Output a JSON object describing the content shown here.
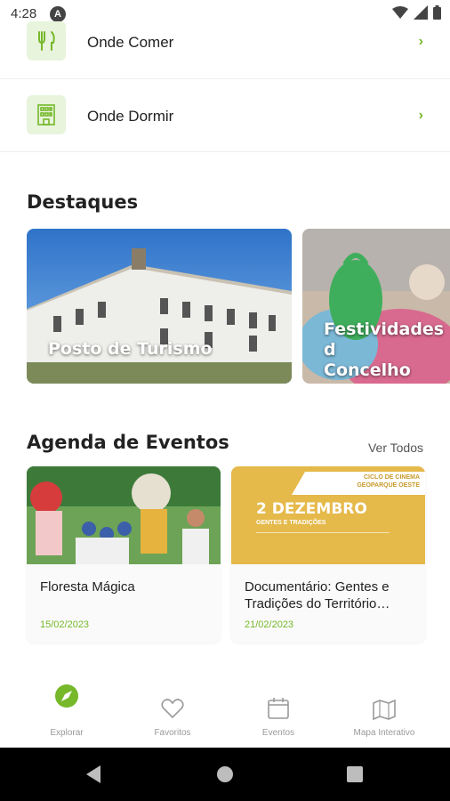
{
  "status_bar": {
    "time": "4:28",
    "notification_icon": "A"
  },
  "menu": [
    {
      "label": "Onde Comer",
      "icon": "fork-knife-icon"
    },
    {
      "label": "Onde Dormir",
      "icon": "hotel-icon"
    }
  ],
  "highlights": {
    "title": "Destaques",
    "items": [
      {
        "caption": "Posto de Turismo"
      },
      {
        "caption_line1": "Festividades d",
        "caption_line2": "Concelho"
      }
    ]
  },
  "events": {
    "title": "Agenda de Eventos",
    "see_all": "Ver Todos",
    "items": [
      {
        "title": "Floresta Mágica",
        "date": "15/02/2023"
      },
      {
        "title": "Documentário: Gentes e Tradições do Território…",
        "date": "21/02/2023",
        "poster": {
          "heading_line1": "CICLO DE CINEMA",
          "heading_line2": "GEOPARQUE OESTE",
          "big_date": "2 DEZEMBRO",
          "subtitle": "GENTES E TRADIÇÕES"
        }
      }
    ]
  },
  "tabs": [
    {
      "label": "Explorar",
      "icon": "compass-icon",
      "active": true
    },
    {
      "label": "Favoritos",
      "icon": "heart-icon"
    },
    {
      "label": "Eventos",
      "icon": "calendar-icon"
    },
    {
      "label": "Mapa Interativo",
      "icon": "map-icon"
    }
  ],
  "colors": {
    "accent": "#76b82a",
    "icon_bg": "#e8f4dc"
  }
}
